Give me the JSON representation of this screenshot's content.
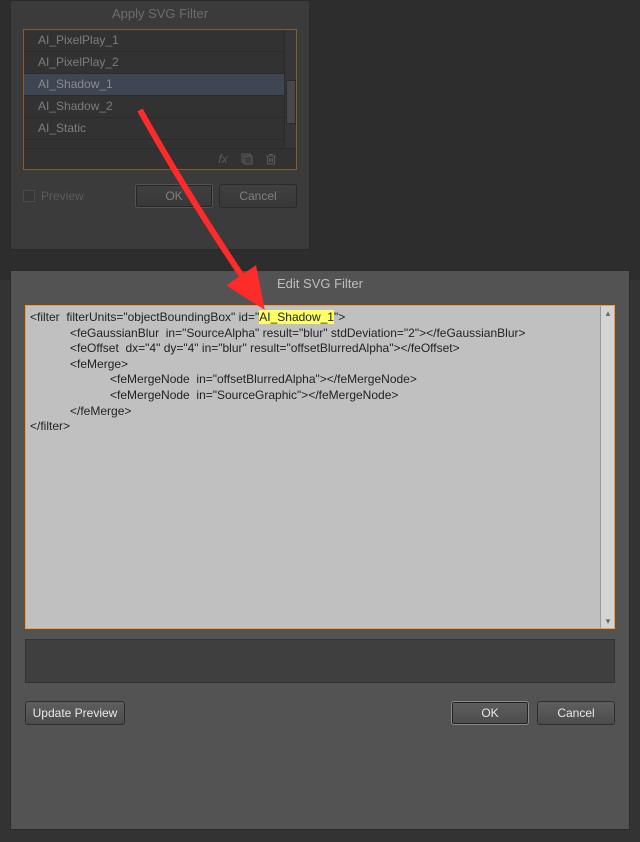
{
  "applyDialog": {
    "title": "Apply SVG Filter",
    "filters": {
      "0": "AI_PixelPlay_1",
      "1": "AI_PixelPlay_2",
      "2": "AI_Shadow_1",
      "3": "AI_Shadow_2",
      "4": "AI_Static"
    },
    "icons": {
      "fx": "fx",
      "newFilter": "▧",
      "trash": "🗑"
    },
    "preview": "Preview",
    "ok": "OK",
    "cancel": "Cancel"
  },
  "editDialog": {
    "title": "Edit SVG Filter",
    "code": {
      "l1a": "<filter  filterUnits=\"objectBoundingBox\" id=\"",
      "l1hl": "AI_Shadow_1",
      "l1b": "\">",
      "l2": "            <feGaussianBlur  in=\"SourceAlpha\" result=\"blur\" stdDeviation=\"2\"></feGaussianBlur>",
      "l3": "            <feOffset  dx=\"4\" dy=\"4\" in=\"blur\" result=\"offsetBlurredAlpha\"></feOffset>",
      "l4": "            <feMerge>",
      "l5": "                        <feMergeNode  in=\"offsetBlurredAlpha\"></feMergeNode>",
      "l6": "                        <feMergeNode  in=\"SourceGraphic\"></feMergeNode>",
      "l7": "            </feMerge>",
      "l8": "</filter>"
    },
    "updatePreview": "Update Preview",
    "ok": "OK",
    "cancel": "Cancel"
  }
}
